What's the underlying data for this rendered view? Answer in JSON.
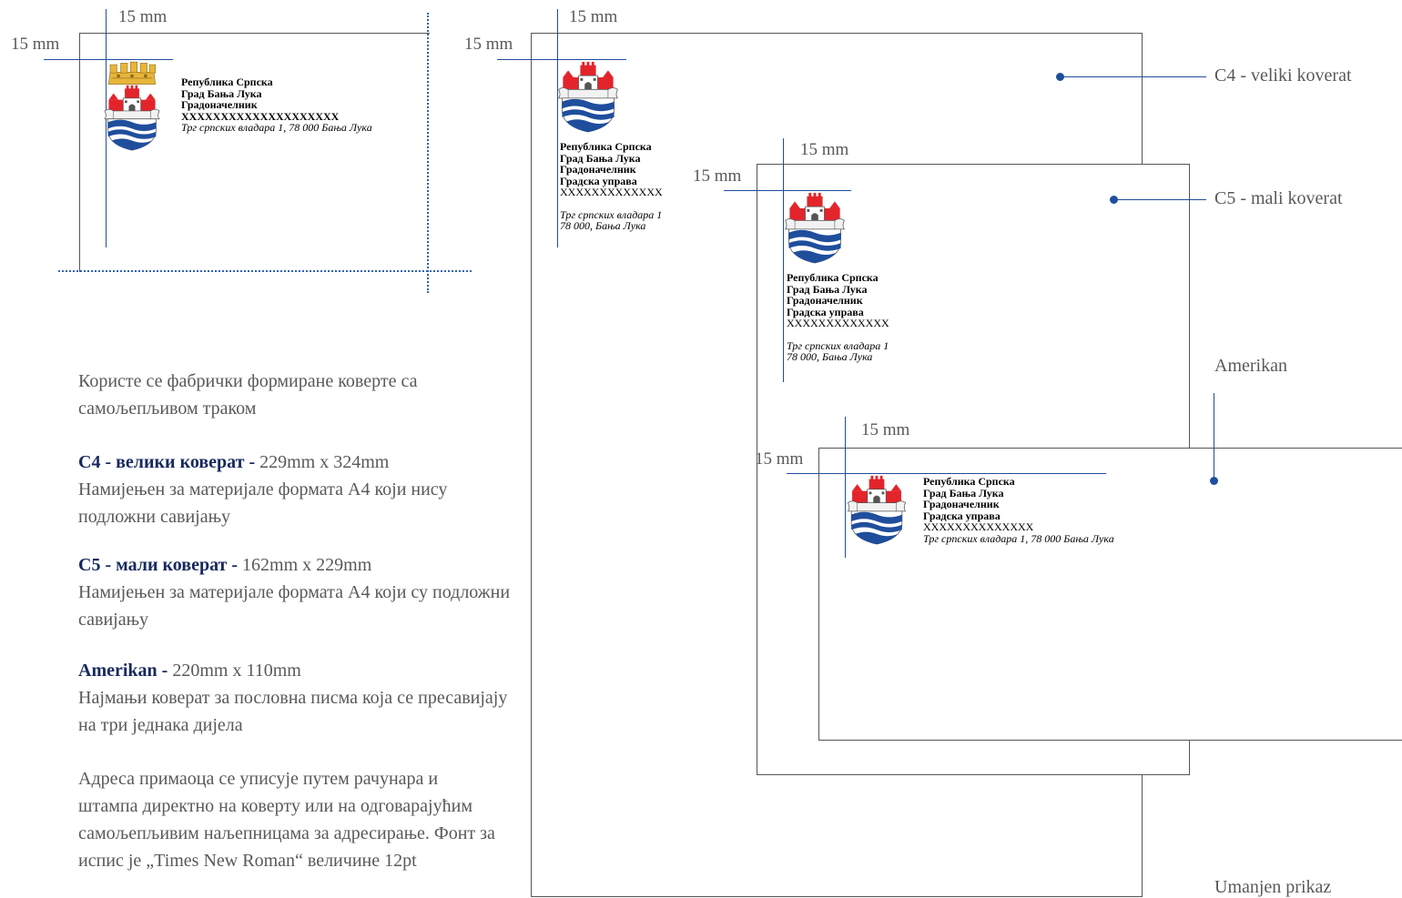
{
  "margin_label": "15 mm",
  "sender_full": {
    "line1": "Република Српска",
    "line2": "Град Бања Лука",
    "line3": "Градоначелник",
    "line4": "XXXXXXXXXXXXXXXXXXXX",
    "address": "Трг српских владара 1, 78 000 Бања Лука"
  },
  "sender_c4": {
    "line1": "Република Српска",
    "line2": "Град Бања Лука",
    "line3": "Градоначелник",
    "line4": "Градска управа",
    "line5": "XXXXXXXXXXXXX",
    "address1": "Трг српских владара 1",
    "address2": "78 000, Бања Лука"
  },
  "sender_c5": {
    "line1": "Република Српска",
    "line2": "Град Бања Лука",
    "line3": "Градоначелник",
    "line4": "Градска управа",
    "line5": "XXXXXXXXXXXXX",
    "address1": "Трг српских владара 1",
    "address2": "78 000, Бања Лука"
  },
  "sender_amerikan": {
    "line1": "Република Српска",
    "line2": "Град Бања Лука",
    "line3": "Градоначелник",
    "line4": "Градска управа",
    "line5": "XXXXXXXXXXXXXX",
    "address": "Трг српских владара 1, 78 000 Бања Лука"
  },
  "callouts": {
    "c4": "C4 - veliki koverat",
    "c5": "C5 - mali koverat",
    "amerikan": "Amerikan",
    "reduced": "Umanjen prikaz"
  },
  "description": {
    "intro": "Користе се фабрички формиране коверте са самољепљивом траком",
    "c4_title": "C4 - велики коверат - ",
    "c4_size": "229mm x 324mm",
    "c4_text": "Намијењен за материјале формата А4 који нису подложни савијању",
    "c5_title": "C5 - мали коверат - ",
    "c5_size": "162mm x 229mm",
    "c5_text": "Намијењен за материјале формата А4 који су подложни савијању",
    "amerikan_title": "Amerikan - ",
    "amerikan_size": "220mm x 110mm",
    "amerikan_text": "Најмањи коверат за пословна писма која се пресавијају на три једнака дијела",
    "address_text": "Адреса примаоца се уписује путем рачунара и штампа директно на коверту или на одговарајућим самољепљивим наљепницама за адресирање. Фонт за испис је „Times New Roman“ величине 12pt"
  },
  "colors": {
    "guide_blue": "#1f4e9c",
    "heading_navy": "#17295e",
    "crest_red": "#e3242b",
    "crest_blue": "#1f4e9c",
    "crown_gold": "#e8b53a"
  },
  "icons": [
    "coat-of-arms-icon",
    "mural-crown-icon"
  ]
}
